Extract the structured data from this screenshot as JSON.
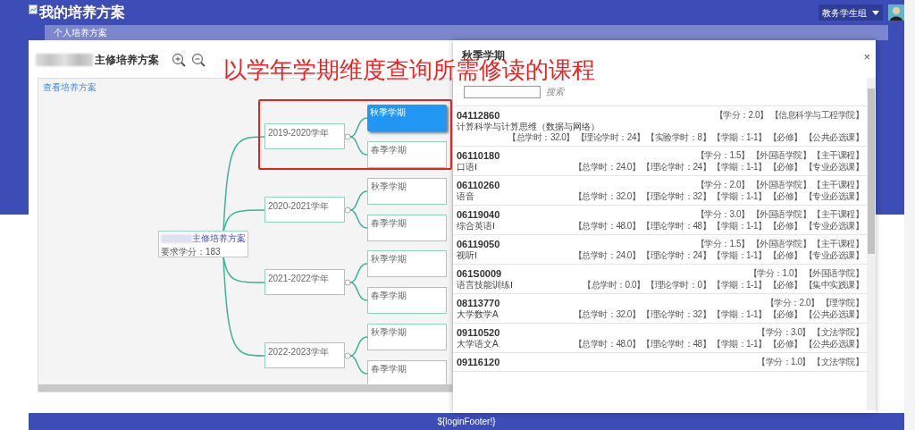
{
  "header": {
    "title": "我的培养方案",
    "user": "教务学生组"
  },
  "tabs": [
    {
      "label": "个人培养方案",
      "selected": true
    }
  ],
  "plan": {
    "title": "主修培养方案",
    "link": "查看培养方案",
    "root": {
      "title": "主修培养方案",
      "credits": "要求学分：183"
    },
    "years": [
      {
        "label": "2019-2020学年",
        "highlighted": true,
        "terms": [
          {
            "label": "秋季学期",
            "selected": true
          },
          {
            "label": "春季学期",
            "selected": false
          }
        ]
      },
      {
        "label": "2020-2021学年",
        "highlighted": false,
        "terms": [
          {
            "label": "秋季学期",
            "selected": false
          },
          {
            "label": "春季学期",
            "selected": false
          }
        ]
      },
      {
        "label": "2021-2022学年",
        "highlighted": false,
        "terms": [
          {
            "label": "秋季学期",
            "selected": false
          },
          {
            "label": "春季学期",
            "selected": false
          }
        ]
      },
      {
        "label": "2022-2023学年",
        "highlighted": false,
        "terms": [
          {
            "label": "秋季学期",
            "selected": false
          },
          {
            "label": "春季学期",
            "selected": false
          }
        ]
      }
    ]
  },
  "annotation": "以学年学期维度查询所需修读的课程",
  "modal": {
    "title": "秋季学期",
    "close": "×",
    "search_button": "搜索",
    "courses": [
      {
        "code": "04112860",
        "tags": [
          "【学分：2.0】",
          "【信息科学与工程学院】"
        ],
        "name": "计算科学与计算思维（数据与网络）",
        "details": [
          "【总学时：32.0】",
          "【理论学时：24】",
          "【实验学时：8】",
          "【学期：1-1】",
          "【必修】",
          "【公共必选课】"
        ]
      },
      {
        "code": "06110180",
        "tags": [
          "【学分：1.5】",
          "【外国语学院】",
          "【主干课程】"
        ],
        "name": "口语Ⅰ",
        "details": [
          "【总学时：24.0】",
          "【理论学时：24】",
          "【学期：1-1】",
          "【必修】",
          "【专业必选课】"
        ]
      },
      {
        "code": "06110260",
        "tags": [
          "【学分：2.0】",
          "【外国语学院】",
          "【主干课程】"
        ],
        "name": "语音",
        "details": [
          "【总学时：32.0】",
          "【理论学时：32】",
          "【学期：1-1】",
          "【必修】",
          "【专业必选课】"
        ]
      },
      {
        "code": "06119040",
        "tags": [
          "【学分：3.0】",
          "【外国语学院】",
          "【主干课程】"
        ],
        "name": "综合英语Ⅰ",
        "details": [
          "【总学时：48.0】",
          "【理论学时：48】",
          "【学期：1-1】",
          "【必修】",
          "【专业必选课】"
        ]
      },
      {
        "code": "06119050",
        "tags": [
          "【学分：1.5】",
          "【外国语学院】",
          "【主干课程】"
        ],
        "name": "视听Ⅰ",
        "details": [
          "【总学时：24.0】",
          "【理论学时：24】",
          "【学期：1-1】",
          "【必修】",
          "【专业必选课】"
        ]
      },
      {
        "code": "061S0009",
        "tags": [
          "【学分：1.0】",
          "【外国语学院】"
        ],
        "name": "语言技能训练Ⅰ",
        "details": [
          "【总学时：0.0】",
          "【理论学时：0】",
          "【学期：1-1】",
          "【必修】",
          "【集中实践课】"
        ]
      },
      {
        "code": "08113770",
        "tags": [
          "【学分：2.0】",
          "【理学院】"
        ],
        "name": "大学数学A",
        "details": [
          "【总学时：32.0】",
          "【理论学时：32】",
          "【学期：1-1】",
          "【必修】",
          "【公共必选课】"
        ]
      },
      {
        "code": "09110520",
        "tags": [
          "【学分：3.0】",
          "【文法学院】"
        ],
        "name": "大学语文A",
        "details": [
          "【总学时：48.0】",
          "【理论学时：48】",
          "【学期：1-1】",
          "【必修】",
          "【公共必选课】"
        ]
      },
      {
        "code": "09116120",
        "tags": [
          "【学分：1.0】",
          "【文法学院】"
        ]
      }
    ]
  },
  "footer": "${loginFooter!}"
}
